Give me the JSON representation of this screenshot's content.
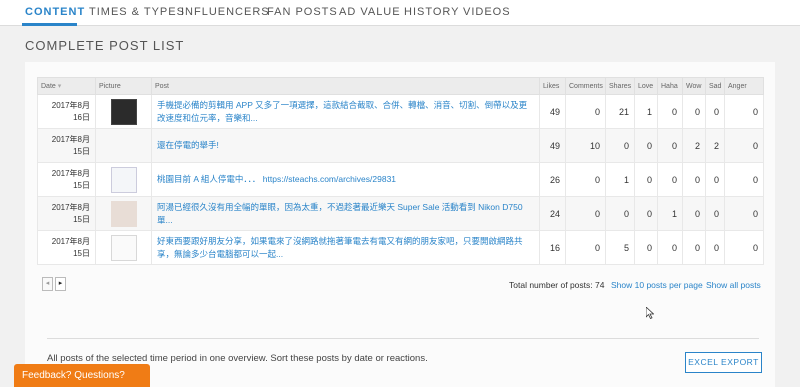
{
  "nav": {
    "tabs": [
      {
        "label": "CONTENT",
        "active": true
      },
      {
        "label": "TIMES & TYPES",
        "active": false
      },
      {
        "label": "INFLUENCERS",
        "active": false
      },
      {
        "label": "FAN POSTS",
        "active": false
      },
      {
        "label": "AD VALUE",
        "active": false
      },
      {
        "label": "HISTORY",
        "active": false
      },
      {
        "label": "VIDEOS",
        "active": false
      }
    ]
  },
  "page_title": "COMPLETE POST LIST",
  "table": {
    "headers": {
      "date": "Date",
      "picture": "Picture",
      "post": "Post",
      "likes": "Likes",
      "comments": "Comments",
      "shares": "Shares",
      "love": "Love",
      "haha": "Haha",
      "wow": "Wow",
      "sad": "Sad",
      "anger": "Anger"
    },
    "rows": [
      {
        "date": "2017年8月16日",
        "thumbnail": "dark",
        "post": "手機提必備的剪輯用 APP 又多了一項選擇，這款結合截取、合併、轉檔、消音、切割、倒帶以及更改速度和位元率，音樂和...",
        "likes": "49",
        "comments": "0",
        "shares": "21",
        "love": "1",
        "haha": "0",
        "wow": "0",
        "sad": "0",
        "anger": "0"
      },
      {
        "date": "2017年8月15日",
        "thumbnail": "none",
        "post": "還在停電的舉手!",
        "likes": "49",
        "comments": "10",
        "shares": "0",
        "love": "0",
        "haha": "0",
        "wow": "2",
        "sad": "2",
        "anger": "0"
      },
      {
        "date": "2017年8月15日",
        "thumbnail": "light",
        "post": "桃園目前 A 組人停電中．．． https://steachs.com/archives/29831",
        "likes": "26",
        "comments": "0",
        "shares": "1",
        "love": "0",
        "haha": "0",
        "wow": "0",
        "sad": "0",
        "anger": "0"
      },
      {
        "date": "2017年8月15日",
        "thumbnail": "person",
        "post": "阿湯已經很久沒有用全幅的單眼，因為太重，不過趁著最近樂天 Super Sale 活動看到 Nikon D750 單...",
        "likes": "24",
        "comments": "0",
        "shares": "0",
        "love": "0",
        "haha": "1",
        "wow": "0",
        "sad": "0",
        "anger": "0"
      },
      {
        "date": "2017年8月15日",
        "thumbnail": "doc",
        "post": "好東西要跟好朋友分享，如果電來了沒網路就拖著筆電去有電又有網的朋友家吧，只要開啟網路共享，無論多少台電腦都可以一起...",
        "likes": "16",
        "comments": "0",
        "shares": "5",
        "love": "0",
        "haha": "0",
        "wow": "0",
        "sad": "0",
        "anger": "0"
      }
    ]
  },
  "pager": {
    "prev": "◂",
    "next": "▸"
  },
  "footer": {
    "total_label": "Total number of posts: 74",
    "show_10": "Show 10 posts per page",
    "show_all": "Show all posts"
  },
  "description": "All posts of the selected time period in one overview. Sort these posts by date or reactions.",
  "export_label": "EXCEL EXPORT",
  "feedback_label": "Feedback? Questions?",
  "colors": {
    "accent": "#2a84c9",
    "feedback": "#f07c15"
  }
}
